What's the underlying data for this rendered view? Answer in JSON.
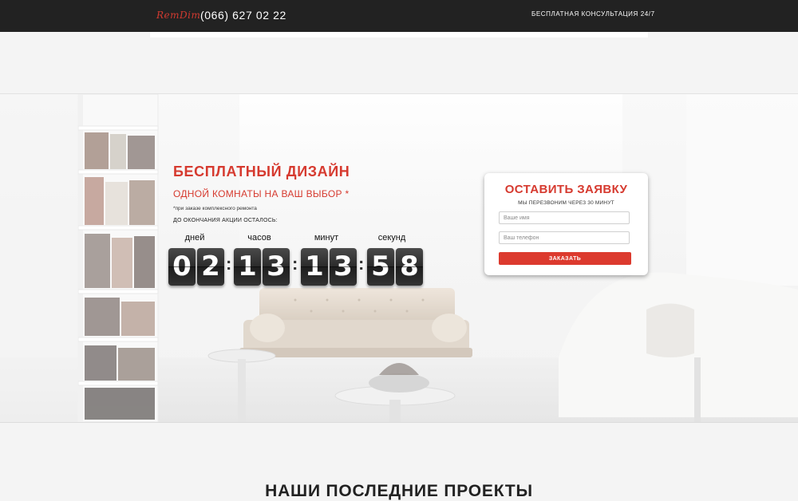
{
  "header": {
    "logo": "RemDim",
    "phone": "(066) 627 02 22",
    "consultation": "БЕСПЛАТНАЯ КОНСУЛЬТАЦИЯ 24/7"
  },
  "promo": {
    "title": "БЕСПЛАТНЫЙ ДИЗАЙН",
    "subtitle": "ОДНОЙ КОМНАТЫ НА ВАШ ВЫБОР *",
    "note": "*при заказе комплексного ремонта",
    "countdown_caption": "ДО ОКОНЧАНИЯ АКЦИИ ОСТАЛОСЬ:",
    "countdown": {
      "labels": {
        "days": "дней",
        "hours": "часов",
        "minutes": "минут",
        "seconds": "секунд"
      },
      "days": [
        "0",
        "2"
      ],
      "hours": [
        "1",
        "3"
      ],
      "minutes": [
        "1",
        "3"
      ],
      "seconds": [
        "5",
        "8"
      ],
      "separator": ":"
    }
  },
  "form": {
    "title": "ОСТАВИТЬ ЗАЯВКУ",
    "subtitle": "МЫ ПЕРЕЗВОНИМ ЧЕРЕЗ 30 МИНУТ",
    "name_placeholder": "Ваше имя",
    "phone_placeholder": "Ваш телефон",
    "submit_label": "ЗАКАЗАТЬ"
  },
  "projects": {
    "title": "НАШИ ПОСЛЕДНИЕ ПРОЕКТЫ"
  },
  "colors": {
    "accent": "#d63a2f",
    "topbar": "#222222",
    "digit_bg": "#2c2c2c"
  }
}
